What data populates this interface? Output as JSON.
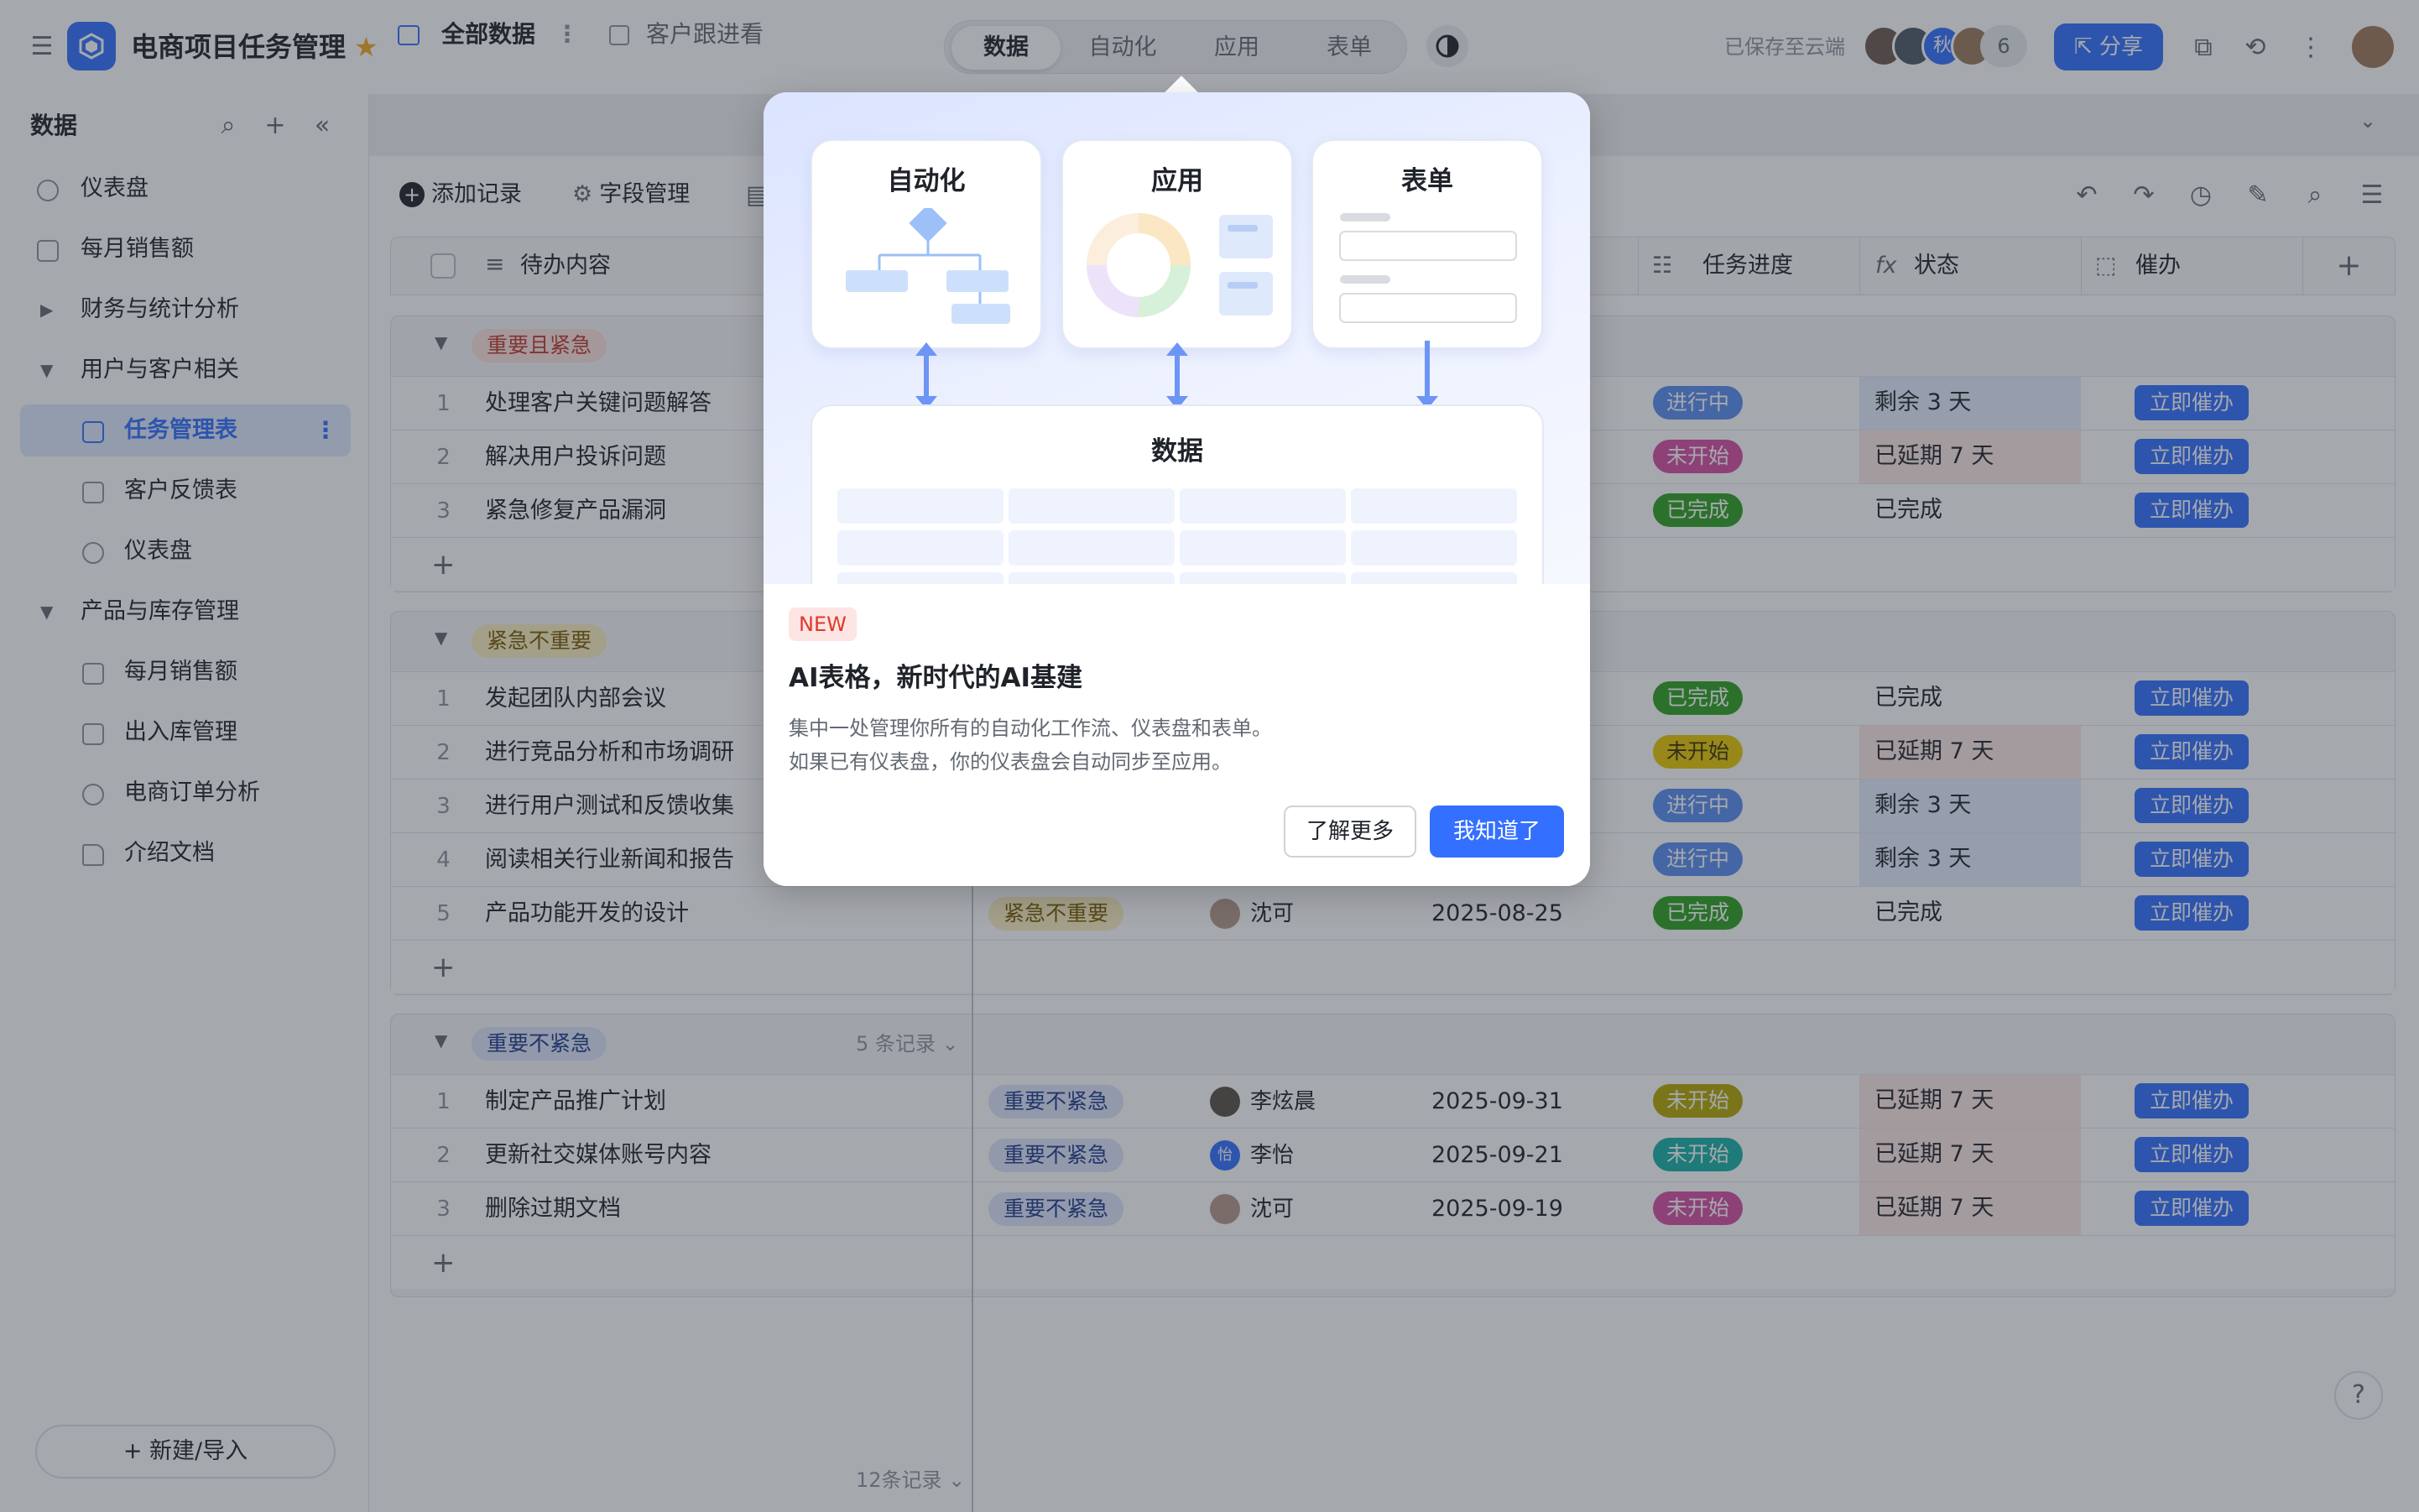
{
  "app": {
    "title": "电商项目任务管理",
    "saved_status": "已保存至云端",
    "collaborator_extra": "6",
    "share_label": "分享"
  },
  "mode_switch": {
    "items": [
      "数据",
      "自动化",
      "应用",
      "表单"
    ],
    "active": "数据"
  },
  "collaborators": [
    {
      "initial": ""
    },
    {
      "initial": ""
    },
    {
      "initial": "秋"
    },
    {
      "initial": ""
    }
  ],
  "sidebar": {
    "title": "数据",
    "new_import_label": "新建/导入",
    "items": [
      {
        "label": "仪表盘"
      },
      {
        "label": "每月销售额"
      },
      {
        "label": "财务与统计分析"
      },
      {
        "label": "用户与客户相关"
      },
      {
        "label": "任务管理表"
      },
      {
        "label": "客户反馈表"
      },
      {
        "label": "仪表盘"
      },
      {
        "label": "产品与库存管理"
      },
      {
        "label": "每月销售额"
      },
      {
        "label": "出入库管理"
      },
      {
        "label": "电商订单分析"
      },
      {
        "label": "介绍文档"
      }
    ]
  },
  "tabs": [
    {
      "label": "全部数据"
    },
    {
      "label": "客户跟进看"
    }
  ],
  "toolbar": {
    "add_record": "添加记录",
    "field_manage": "字段管理"
  },
  "columns": {
    "title": "待办内容",
    "progress": "任务进度",
    "status": "状态",
    "urge": "催办"
  },
  "groups": [
    {
      "name": "重要且紧急",
      "rows": [
        {
          "no": "1",
          "title": "处理客户关键问题解答",
          "progress": "进行中",
          "status": "剩余 3 天",
          "urge": "立即催办"
        },
        {
          "no": "2",
          "title": "解决用户投诉问题",
          "progress": "未开始",
          "status": "已延期 7 天",
          "urge": "立即催办"
        },
        {
          "no": "3",
          "title": "紧急修复产品漏洞",
          "progress": "已完成",
          "status": "已完成",
          "urge": "立即催办"
        }
      ]
    },
    {
      "name": "紧急不重要",
      "rows": [
        {
          "no": "1",
          "title": "发起团队内部会议",
          "progress": "已完成",
          "status": "已完成",
          "urge": "立即催办"
        },
        {
          "no": "2",
          "title": "进行竞品分析和市场调研",
          "progress": "未开始",
          "status": "已延期 7 天",
          "urge": "立即催办"
        },
        {
          "no": "3",
          "title": "进行用户测试和反馈收集",
          "progress": "进行中",
          "status": "剩余 3 天",
          "urge": "立即催办"
        },
        {
          "no": "4",
          "title": "阅读相关行业新闻和报告",
          "progress": "进行中",
          "status": "剩余 3 天",
          "urge": "立即催办"
        },
        {
          "no": "5",
          "title": "产品功能开发的设计",
          "tag": "紧急不重要",
          "owner": "沈可",
          "date": "2025-08-25",
          "progress": "已完成",
          "status": "已完成",
          "urge": "立即催办"
        }
      ]
    },
    {
      "name": "重要不紧急",
      "count": "5 条记录",
      "rows": [
        {
          "no": "1",
          "title": "制定产品推广计划",
          "tag": "重要不紧急",
          "owner": "李炫晨",
          "date": "2025-09-31",
          "progress": "未开始",
          "status": "已延期 7 天",
          "urge": "立即催办"
        },
        {
          "no": "2",
          "title": "更新社交媒体账号内容",
          "tag": "重要不紧急",
          "owner": "李怡",
          "owner_initial": "怡",
          "date": "2025-09-21",
          "progress": "未开始",
          "status": "已延期 7 天",
          "urge": "立即催办"
        },
        {
          "no": "3",
          "title": "删除过期文档",
          "tag": "重要不紧急",
          "owner": "沈可",
          "date": "2025-09-19",
          "progress": "未开始",
          "status": "已延期 7 天",
          "urge": "立即催办"
        }
      ]
    }
  ],
  "footer": {
    "total": "12条记录"
  },
  "modal": {
    "cards": {
      "automation": "自动化",
      "app": "应用",
      "form": "表单",
      "data": "数据"
    },
    "badge": "NEW",
    "title": "AI表格，新时代的AI基建",
    "desc_line1": "集中一处管理你所有的自动化工作流、仪表盘和表单。",
    "desc_line2": "如果已有仪表盘，你的仪表盘会自动同步至应用。",
    "learn_more": "了解更多",
    "got_it": "我知道了"
  },
  "colors": {
    "accent": "#3370ff",
    "in_progress": "#5b8ef0",
    "not_started_yellow": "#d6b400",
    "not_started_pink": "#d64ea3",
    "not_started_teal": "#17b2a6",
    "done": "#2ea121"
  }
}
